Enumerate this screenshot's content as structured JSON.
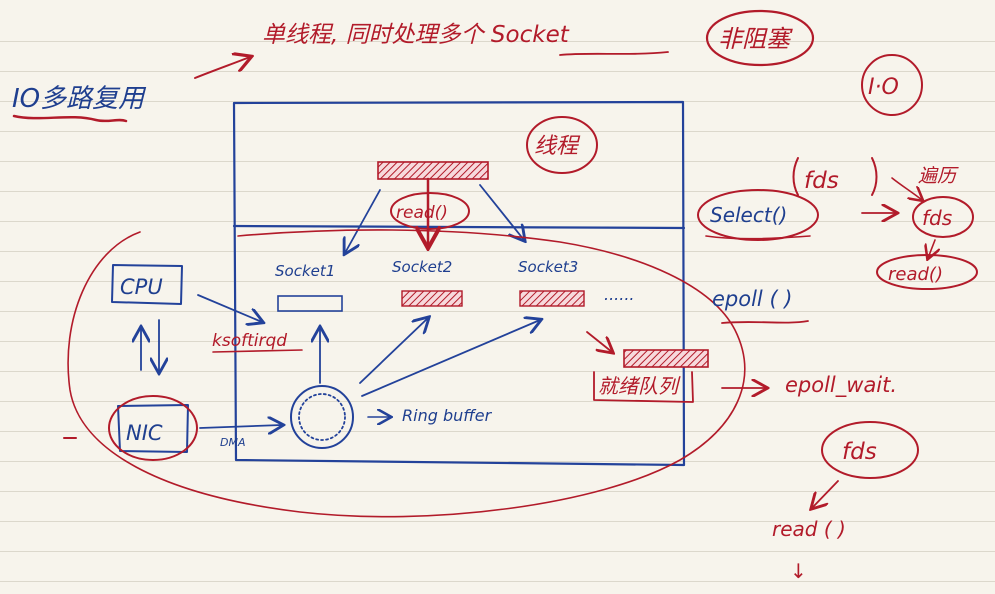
{
  "title": {
    "heading": "IO多路复用",
    "subtitle": "单线程, 同时处理多个 Socket",
    "non_blocking": "非阻塞",
    "io_tag": "I·O"
  },
  "process": {
    "thread_label": "线程",
    "read_label": "read()"
  },
  "sockets": [
    {
      "label": "Socket1",
      "buffer_state": "empty"
    },
    {
      "label": "Socket2",
      "buffer_state": "filled"
    },
    {
      "label": "Socket3",
      "buffer_state": "filled"
    }
  ],
  "ellipsis": "......",
  "hardware": {
    "cpu": "CPU",
    "nic": "NIC",
    "dma": "DMA",
    "softirq": "ksoftirqd",
    "ring_buffer": "Ring buffer"
  },
  "select_flow": {
    "fds_top": "fds",
    "select": "Select()",
    "traverse": "遍历",
    "fds_result": "fds",
    "read": "read()"
  },
  "epoll_flow": {
    "epoll": "epoll ( )",
    "ready_queue": "就绪队列",
    "epoll_wait": "epoll_wait.",
    "fds": "fds",
    "read": "read ( )",
    "down_mark": "↓"
  },
  "colors": {
    "blue_ink": "#1f3f8f",
    "red_ink": "#b21b2a",
    "paper": "#f7f4ec",
    "rule_line": "#dcd8cc"
  }
}
